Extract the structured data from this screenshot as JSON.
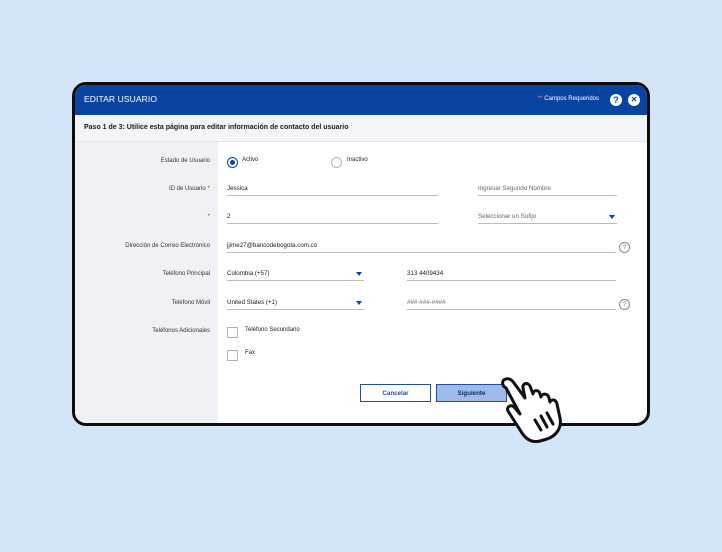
{
  "header": {
    "title": "EDITAR USUARIO",
    "required_label": "Campos Requeridos",
    "required_mark": "**",
    "help_glyph": "?",
    "close_glyph": "✕"
  },
  "subheader": {
    "text": "Paso 1 de 3: Utilice esta página para editar información de contacto del usuario"
  },
  "labels": {
    "estado": "Estado de Usuario",
    "id": "ID de Usuario",
    "required_star": "*",
    "email": "Dirección de Correo Electrónico",
    "telefono_principal": "Teléfono Principal",
    "telefono_movil": "Teléfono Móvil",
    "adicionales": "Teléfonos Adicionales"
  },
  "status": {
    "options": [
      "Activo",
      "Inactivo"
    ],
    "selected": "Activo"
  },
  "fields": {
    "first_name": "Jessica",
    "middle_name_placeholder": "Ingresar Segundo Nombre",
    "last_name": "2",
    "suffix_placeholder": "Seleccionar un Sufijo",
    "email": "jjime27@bancodebogota.com.co",
    "main_country": "Colombia (+57)",
    "main_phone": "313 4409434",
    "mobile_country": "United States (+1)",
    "mobile_phone_placeholder": "###-###-####"
  },
  "additional": {
    "secondary_label": "Teléfono Secundario",
    "secondary_checked": false,
    "fax_label": "Fax",
    "fax_checked": false
  },
  "buttons": {
    "cancel": "Cancelar",
    "next": "Siguiente"
  },
  "colors": {
    "header_bg": "#0a44a3",
    "page_bg": "#d3e5f7",
    "required_mark": "#d81f1f"
  }
}
